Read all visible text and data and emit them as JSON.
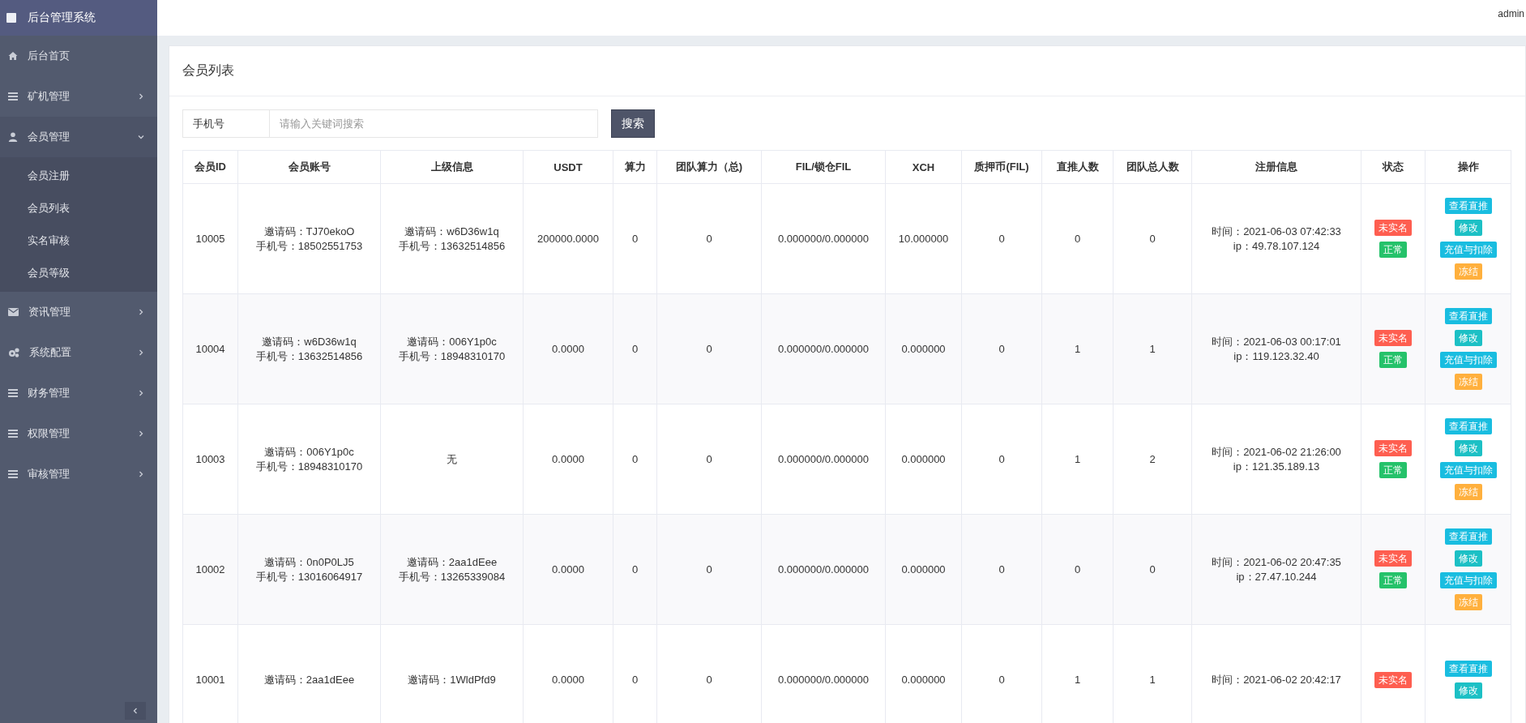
{
  "sidebar": {
    "title": "后台管理系统",
    "items": [
      {
        "label": "后台首页",
        "kind": "link"
      },
      {
        "label": "矿机管理",
        "kind": "group",
        "expanded": false
      },
      {
        "label": "会员管理",
        "kind": "group",
        "expanded": true,
        "children": [
          {
            "label": "会员注册"
          },
          {
            "label": "会员列表"
          },
          {
            "label": "实名审核"
          },
          {
            "label": "会员等级"
          }
        ]
      },
      {
        "label": "资讯管理",
        "kind": "group",
        "expanded": false
      },
      {
        "label": "系统配置",
        "kind": "group",
        "expanded": false
      },
      {
        "label": "财务管理",
        "kind": "group",
        "expanded": false
      },
      {
        "label": "权限管理",
        "kind": "group",
        "expanded": false
      },
      {
        "label": "审核管理",
        "kind": "group",
        "expanded": false
      }
    ]
  },
  "header": {
    "user": "admin"
  },
  "page_title": "会员列表",
  "search": {
    "field": "手机号",
    "placeholder": "请输入关键词搜索",
    "button": "搜索"
  },
  "table": {
    "columns": [
      "会员ID",
      "会员账号",
      "上级信息",
      "USDT",
      "算力",
      "团队算力（总)",
      "FIL/锁仓FIL",
      "XCH",
      "质押币(FIL)",
      "直推人数",
      "团队总人数",
      "注册信息",
      "状态",
      "操作"
    ],
    "rows": [
      {
        "id": "10005",
        "account": [
          "邀请码：TJ70ekoO",
          "手机号：18502551753"
        ],
        "parent": [
          "邀请码：w6D36w1q",
          "手机号：13632514856"
        ],
        "usdt": "200000.0000",
        "power": "0",
        "team_power": "0",
        "fil": "0.000000/0.000000",
        "xch": "10.000000",
        "pledge": "0",
        "direct": "0",
        "team_total": "0",
        "reg": [
          "时间：2021-06-03 07:42:33",
          "ip：49.78.107.124"
        ],
        "status": [
          {
            "label": "未实名",
            "kind": "unverified"
          },
          {
            "label": "正常",
            "kind": "normal"
          }
        ],
        "actions": [
          {
            "label": "查看直推",
            "kind": "view"
          },
          {
            "label": "修改",
            "kind": "edit"
          },
          {
            "label": "充值与扣除",
            "kind": "recharge"
          },
          {
            "label": "冻结",
            "kind": "freeze"
          }
        ]
      },
      {
        "id": "10004",
        "account": [
          "邀请码：w6D36w1q",
          "手机号：13632514856"
        ],
        "parent": [
          "邀请码：006Y1p0c",
          "手机号：18948310170"
        ],
        "usdt": "0.0000",
        "power": "0",
        "team_power": "0",
        "fil": "0.000000/0.000000",
        "xch": "0.000000",
        "pledge": "0",
        "direct": "1",
        "team_total": "1",
        "reg": [
          "时间：2021-06-03 00:17:01",
          "ip：119.123.32.40"
        ],
        "status": [
          {
            "label": "未实名",
            "kind": "unverified"
          },
          {
            "label": "正常",
            "kind": "normal"
          }
        ],
        "actions": [
          {
            "label": "查看直推",
            "kind": "view"
          },
          {
            "label": "修改",
            "kind": "edit"
          },
          {
            "label": "充值与扣除",
            "kind": "recharge"
          },
          {
            "label": "冻结",
            "kind": "freeze"
          }
        ]
      },
      {
        "id": "10003",
        "account": [
          "邀请码：006Y1p0c",
          "手机号：18948310170"
        ],
        "parent": [
          "无"
        ],
        "usdt": "0.0000",
        "power": "0",
        "team_power": "0",
        "fil": "0.000000/0.000000",
        "xch": "0.000000",
        "pledge": "0",
        "direct": "1",
        "team_total": "2",
        "reg": [
          "时间：2021-06-02 21:26:00",
          "ip：121.35.189.13"
        ],
        "status": [
          {
            "label": "未实名",
            "kind": "unverified"
          },
          {
            "label": "正常",
            "kind": "normal"
          }
        ],
        "actions": [
          {
            "label": "查看直推",
            "kind": "view"
          },
          {
            "label": "修改",
            "kind": "edit"
          },
          {
            "label": "充值与扣除",
            "kind": "recharge"
          },
          {
            "label": "冻结",
            "kind": "freeze"
          }
        ]
      },
      {
        "id": "10002",
        "account": [
          "邀请码：0n0P0LJ5",
          "手机号：13016064917"
        ],
        "parent": [
          "邀请码：2aa1dEee",
          "手机号：13265339084"
        ],
        "usdt": "0.0000",
        "power": "0",
        "team_power": "0",
        "fil": "0.000000/0.000000",
        "xch": "0.000000",
        "pledge": "0",
        "direct": "0",
        "team_total": "0",
        "reg": [
          "时间：2021-06-02 20:47:35",
          "ip：27.47.10.244"
        ],
        "status": [
          {
            "label": "未实名",
            "kind": "unverified"
          },
          {
            "label": "正常",
            "kind": "normal"
          }
        ],
        "actions": [
          {
            "label": "查看直推",
            "kind": "view"
          },
          {
            "label": "修改",
            "kind": "edit"
          },
          {
            "label": "充值与扣除",
            "kind": "recharge"
          },
          {
            "label": "冻结",
            "kind": "freeze"
          }
        ]
      },
      {
        "id": "10001",
        "account": [
          "邀请码：2aa1dEee"
        ],
        "parent": [
          "邀请码：1WldPfd9"
        ],
        "usdt": "0.0000",
        "power": "0",
        "team_power": "0",
        "fil": "0.000000/0.000000",
        "xch": "0.000000",
        "pledge": "0",
        "direct": "1",
        "team_total": "1",
        "reg": [
          "时间：2021-06-02 20:42:17"
        ],
        "status": [
          {
            "label": "未实名",
            "kind": "unverified"
          }
        ],
        "actions": [
          {
            "label": "查看直推",
            "kind": "view"
          },
          {
            "label": "修改",
            "kind": "edit"
          }
        ]
      }
    ]
  }
}
